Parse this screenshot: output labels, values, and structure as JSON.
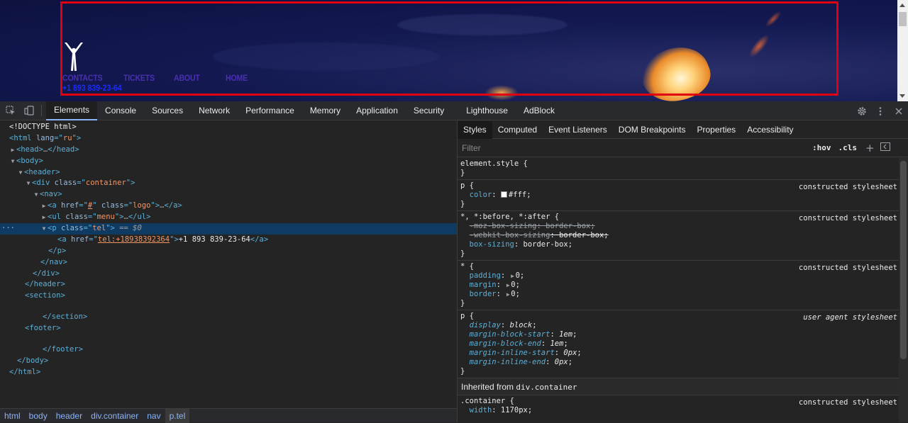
{
  "page": {
    "menu": [
      "contacts",
      "tickets",
      "about",
      "home"
    ],
    "tel": "+1 893 839-23-64"
  },
  "devtools": {
    "tabs": [
      "Elements",
      "Console",
      "Sources",
      "Network",
      "Performance",
      "Memory",
      "Application",
      "Security",
      "Lighthouse",
      "AdBlock"
    ],
    "active_tab": "Elements",
    "tree": {
      "doctype": "<!DOCTYPE html>",
      "html_lang": "ru",
      "container_class": "container",
      "logo_href": "#",
      "logo_class": "logo",
      "menu_class": "menu",
      "tel_class": "tel",
      "tel_href": "tel:+18938392364",
      "tel_text": "+1 893 839-23-64",
      "dollar": "== $0"
    },
    "breadcrumbs": [
      "html",
      "body",
      "header",
      "div.container",
      "nav",
      "p.tel"
    ],
    "styles": {
      "sub_tabs": [
        "Styles",
        "Computed",
        "Event Listeners",
        "DOM Breakpoints",
        "Properties",
        "Accessibility"
      ],
      "filter_placeholder": "Filter",
      "hov": ":hov",
      "cls": ".cls",
      "source_constructed": "constructed stylesheet",
      "source_ua": "user agent stylesheet",
      "inherited_label": "Inherited from",
      "inherited_from": "div.container",
      "color_value": "#fff"
    }
  },
  "colors": {
    "accent_highlight": "#e00010",
    "menu_text": "#4a2fb0",
    "tel_text": "#1a2bff",
    "selection_bg": "#0f3b63"
  }
}
